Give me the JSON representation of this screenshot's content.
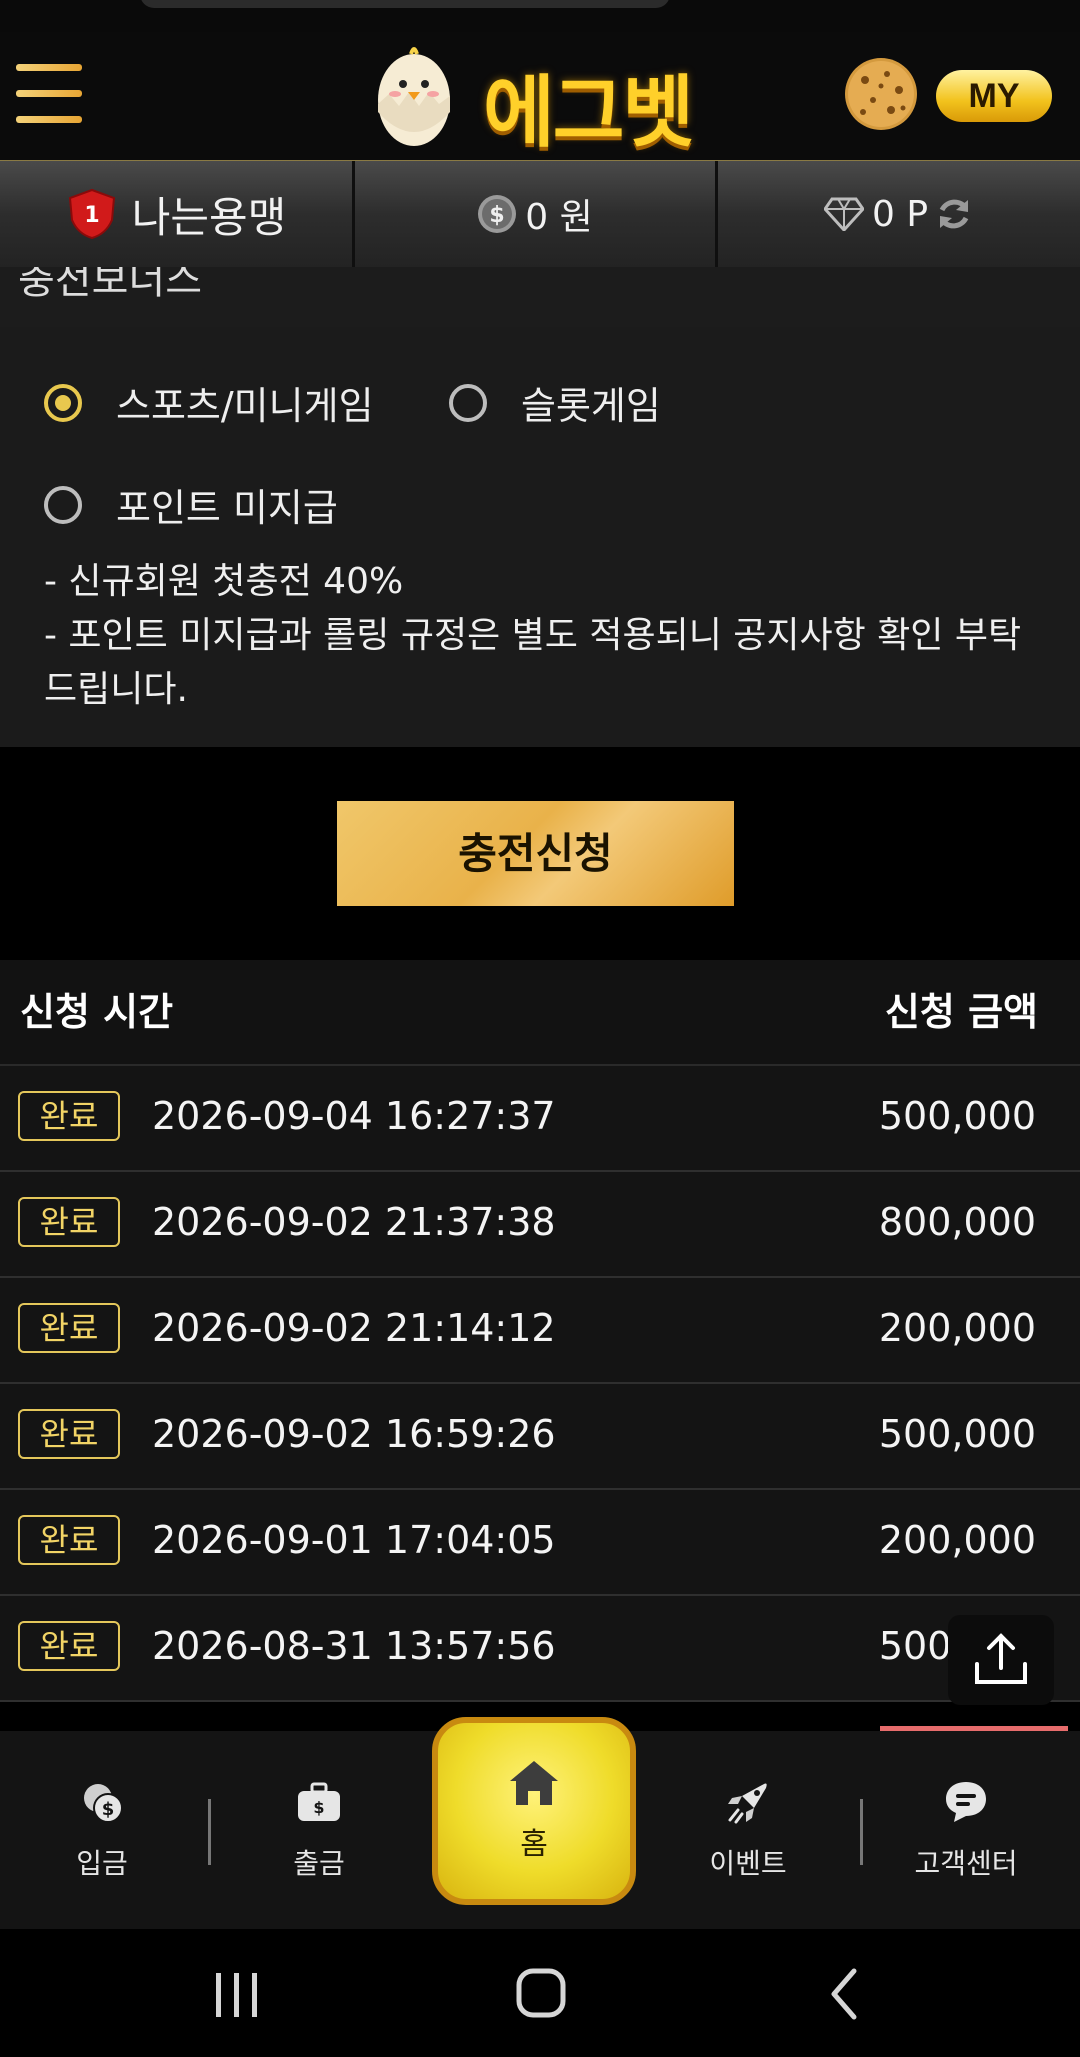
{
  "header": {
    "logo_text": "에그벳",
    "my_button": "MY"
  },
  "user_bar": {
    "level": "1",
    "nickname": "나는용맹",
    "balance": "0 원",
    "points": "0 P"
  },
  "bonus": {
    "section_title": "충전보너스",
    "options": [
      {
        "label": "스포츠/미니게임",
        "selected": true
      },
      {
        "label": "슬롯게임",
        "selected": false
      },
      {
        "label": "포인트 미지급",
        "selected": false
      }
    ],
    "notes": [
      "- 신규회원 첫충전 40%",
      "- 포인트 미지급과 롤링 규정은 별도 적용되니 공지사항 확인 부탁드립니다."
    ]
  },
  "charge_button": "충전신청",
  "history": {
    "col_time": "신청 시간",
    "col_amount": "신청 금액",
    "rows": [
      {
        "status": "완료",
        "time": "2026-09-04 16:27:37",
        "amount": "500,000"
      },
      {
        "status": "완료",
        "time": "2026-09-02 21:37:38",
        "amount": "800,000"
      },
      {
        "status": "완료",
        "time": "2026-09-02 21:14:12",
        "amount": "200,000"
      },
      {
        "status": "완료",
        "time": "2026-09-02 16:59:26",
        "amount": "500,000"
      },
      {
        "status": "완료",
        "time": "2026-09-01 17:04:05",
        "amount": "200,000"
      },
      {
        "status": "완료",
        "time": "2026-08-31 13:57:56",
        "amount": "500,000"
      }
    ]
  },
  "bottom_nav": {
    "deposit": "입금",
    "withdraw": "출금",
    "home": "홈",
    "event": "이벤트",
    "support": "고객센터"
  },
  "colors": {
    "accent_gold": "#e8c84e",
    "badge_gold": "#f2d466",
    "nav_accent": "#e66c6c"
  },
  "icons": [
    "menu-icon",
    "egg-mascot-icon",
    "cookie-icon",
    "level-shield-icon",
    "coin-icon",
    "diamond-icon",
    "refresh-icon",
    "scroll-top-icon",
    "deposit-coins-icon",
    "briefcase-icon",
    "home-icon",
    "rocket-icon",
    "chat-icon"
  ]
}
